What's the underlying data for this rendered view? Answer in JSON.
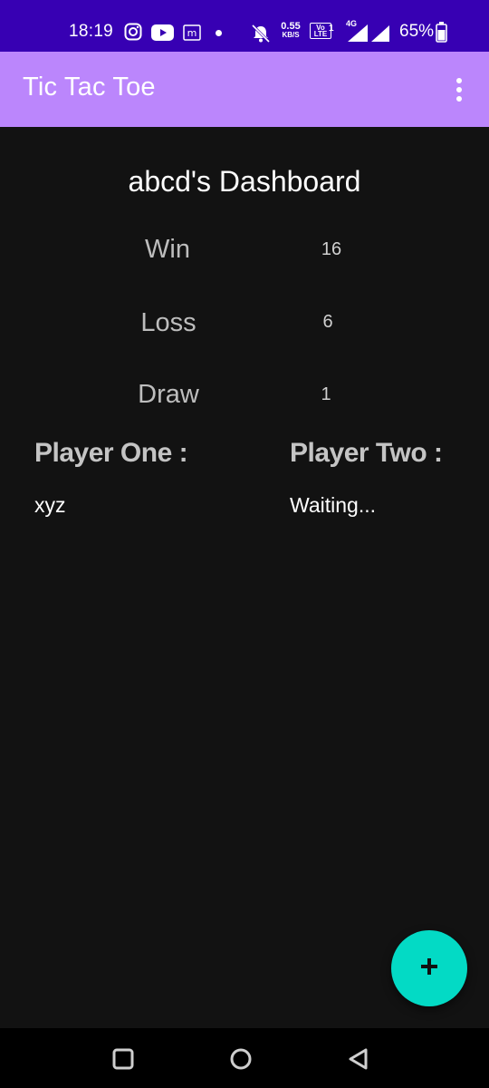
{
  "status_bar": {
    "time": "18:19",
    "net_speed_value": "0.55",
    "net_speed_unit": "KB/S",
    "volte_top": "Vo",
    "volte_bottom": "LTE",
    "sim_slot": "1",
    "network_type": "4G",
    "battery_percent": "65%",
    "icons": [
      "instagram-icon",
      "youtube-icon",
      "messenger-icon",
      "notification-dot",
      "mute-bell-icon",
      "signal-icon",
      "battery-icon"
    ]
  },
  "app_bar": {
    "title": "Tic Tac Toe",
    "menu_icon": "more-vert-icon"
  },
  "dashboard": {
    "title": "abcd's Dashboard",
    "stats": [
      {
        "label": "Win",
        "value": "16"
      },
      {
        "label": "Loss",
        "value": "6"
      },
      {
        "label": "Draw",
        "value": "1"
      }
    ]
  },
  "players": {
    "one": {
      "heading": "Player One :",
      "name": "xyz"
    },
    "two": {
      "heading": "Player Two :",
      "name": "Waiting..."
    }
  },
  "fab": {
    "icon": "plus-icon",
    "color": "#03dac5"
  },
  "nav_bar": {
    "buttons": [
      "recents-button",
      "home-button",
      "back-button"
    ]
  },
  "colors": {
    "status_bar": "#3700b3",
    "app_bar": "#bb86fc",
    "background": "#121212",
    "accent": "#03dac5"
  }
}
